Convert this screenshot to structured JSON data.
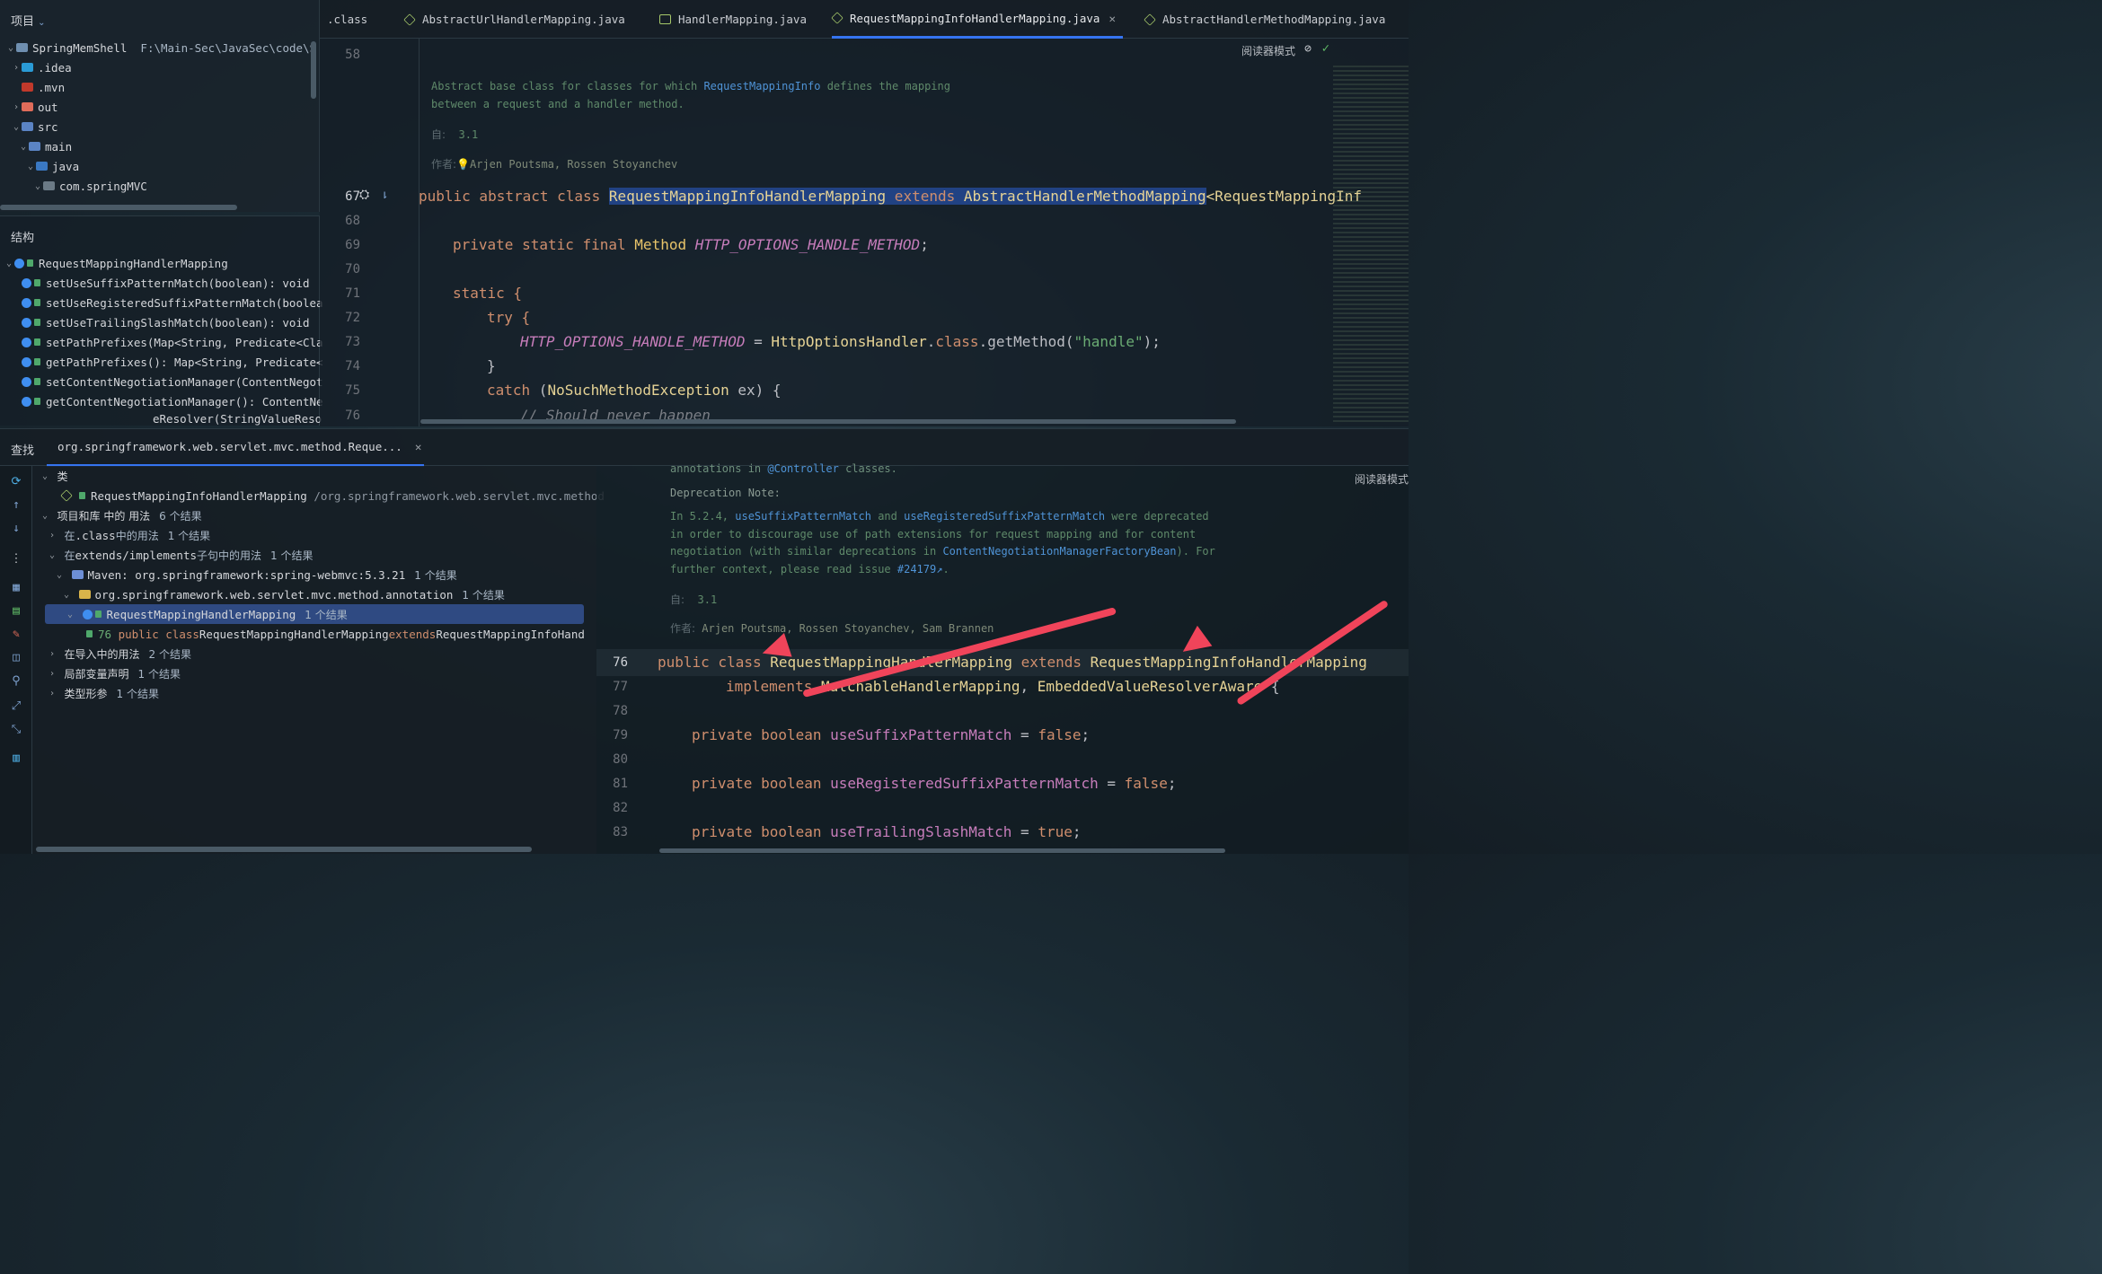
{
  "project_panel": {
    "header": "项目",
    "root_name": "SpringMemShell",
    "root_path": "F:\\Main-Sec\\JavaSec\\code\\S",
    "items": [
      ".idea",
      ".mvn",
      "out",
      "src",
      "main",
      "java",
      "com.springMVC"
    ]
  },
  "structure_panel": {
    "title": "结构",
    "class_name": "RequestMappingHandlerMapping",
    "members": [
      "setUseSuffixPatternMatch(boolean): void",
      "setUseRegisteredSuffixPatternMatch(boolea",
      "setUseTrailingSlashMatch(boolean): void",
      "setPathPrefixes(Map<String, Predicate<Cla",
      "getPathPrefixes(): Map<String, Predicate<",
      "setContentNegotiationManager(ContentNegot",
      "getContentNegotiationManager(): ContentNe",
      "eResolver(StringValueReso"
    ]
  },
  "editor_tabs": [
    {
      "label": ".class"
    },
    {
      "label": "AbstractUrlHandlerMapping.java"
    },
    {
      "label": "HandlerMapping.java"
    },
    {
      "label": "RequestMappingInfoHandlerMapping.java",
      "active": true
    },
    {
      "label": "AbstractHandlerMethodMapping.java"
    }
  ],
  "reader_mode_label": "阅读器模式",
  "editor_top": {
    "line_numbers": [
      "58",
      "67",
      "68",
      "69",
      "70",
      "71",
      "72",
      "73",
      "74",
      "75",
      "76"
    ],
    "doc": {
      "line1_a": "Abstract base class for classes for which ",
      "line1_ref": "RequestMappingInfo",
      "line1_b": " defines the mapping",
      "line2": "between a request and a handler method.",
      "since_label": "自:",
      "since_value": "3.1",
      "author_label": "作者:",
      "authors": "Arjen Poutsma, Rossen Stoyanchev"
    },
    "code": {
      "l67_kw": "public abstract class ",
      "l67_cls": "RequestMappingInfoHandlerMapping",
      "l67_ext": " extends ",
      "l67_parent": "AbstractHandlerMethodMapping",
      "l67_rest": "<RequestMappingInf",
      "l69_kw": "private static final ",
      "l69_type": "Method ",
      "l69_field": "HTTP_OPTIONS_HANDLE_METHOD",
      "l69_end": ";",
      "l71": "static {",
      "l72": "try {",
      "l73_field": "HTTP_OPTIONS_HANDLE_METHOD",
      "l73_eq": " = ",
      "l73_cls": "HttpOptionsHandler",
      "l73_dot": ".",
      "l73_kw": "class",
      "l73_call": ".getMethod(",
      "l73_str": "\"handle\"",
      "l73_end": ");",
      "l74": "}",
      "l75_kw": "catch ",
      "l75_rest1": "(",
      "l75_cls": "NoSuchMethodException",
      "l75_rest2": " ex) {",
      "l76": "// Should never happen"
    }
  },
  "find_panel": {
    "tab_label": "查找",
    "search_tab": "org.springframework.web.servlet.mvc.method.Reque...",
    "rows": {
      "class_group": "类",
      "class_item": "RequestMappingInfoHandlerMapping",
      "class_item_pkg": "/org.springframework.web.servlet.mvc.method",
      "usages_label": "项目和库 中的 用法",
      "usages_count": "6 个结果",
      "dotclass_a": "在 ",
      "dotclass_b": ".class",
      "dotclass_c": " 中的用法",
      "dotclass_count": "1 个结果",
      "ext_a": "在 ",
      "ext_b": "extends/implements",
      "ext_c": " 子句中的用法",
      "ext_count": "1 个结果",
      "maven": "Maven: org.springframework:spring-webmvc:5.3.21",
      "maven_count": "1 个结果",
      "pkg": "org.springframework.web.servlet.mvc.method.annotation",
      "pkg_count": "1 个结果",
      "sel_class": "RequestMappingHandlerMapping",
      "sel_count": "1 个结果",
      "usage_line": "76",
      "usage_kw": "public class ",
      "usage_name": "RequestMappingHandlerMapping",
      "usage_ext": " extends ",
      "usage_parent": "RequestMappingInfoHand",
      "import_label": "在导入中的用法",
      "import_count": "2 个结果",
      "local_label": "局部变量声明",
      "local_count": "1 个结果",
      "type_label": "类型形参",
      "type_count": "1 个结果"
    }
  },
  "editor_bottom": {
    "reader_mode_label": "阅读器模式",
    "line_numbers": [
      "76",
      "77",
      "78",
      "79",
      "80",
      "81",
      "82",
      "83"
    ],
    "doc": {
      "top_a": "annotations in ",
      "top_ref": "@Controller",
      "top_b": " classes.",
      "note_title": "Deprecation Note:",
      "note1_a": "In 5.2.4, ",
      "note1_ref1": "useSuffixPatternMatch",
      "note1_b": " and ",
      "note1_ref2": "useRegisteredSuffixPatternMatch",
      "note1_c": " were deprecated",
      "note2": "in order to discourage use of path extensions for request mapping and for content",
      "note3_a": "negotiation (with similar deprecations in ",
      "note3_ref": "ContentNegotiationManagerFactoryBean",
      "note3_b": "). For",
      "note4_a": "further context, please read issue ",
      "note4_ref": "#24179",
      "note4_b": ".",
      "since_label": "自:",
      "since_value": "3.1",
      "author_label": "作者:",
      "authors": "Arjen Poutsma, Rossen Stoyanchev, Sam Brannen"
    },
    "code": {
      "l76_kw": "public class ",
      "l76_cls": "RequestMappingHandlerMapping",
      "l76_ext": " extends ",
      "l76_parent": "RequestMappingInfoHandlerMapping",
      "l77_kw": "implements ",
      "l77_i1": "MatchableHandlerMapping",
      "l77_sep": ", ",
      "l77_i2": "EmbeddedValueResolverAware",
      "l77_end": " {",
      "l79_kw": "private boolean ",
      "l79_f": "useSuffixPatternMatch",
      "l79_eq": " = ",
      "l79_v": "false",
      "l79_end": ";",
      "l81_kw": "private boolean ",
      "l81_f": "useRegisteredSuffixPatternMatch",
      "l81_eq": " = ",
      "l81_v": "false",
      "l81_end": ";",
      "l83_kw": "private boolean ",
      "l83_f": "useTrailingSlashMatch",
      "l83_eq": " = ",
      "l83_v": "true",
      "l83_end": ";"
    }
  },
  "colors": {
    "keyword": "#cf8e6d",
    "class_name": "#e6d395",
    "field": "#c77dbb",
    "string": "#6aab73",
    "selection": "#214283",
    "annotation_arrow": "#f0445a",
    "tab_underline": "#3574f0"
  },
  "icons": [
    "chevron-down-icon",
    "chevron-right-icon",
    "folder-icon",
    "java-class-icon",
    "interface-icon",
    "close-icon",
    "refresh-icon",
    "arrow-up-icon",
    "arrow-down-icon",
    "more-icon",
    "expand-icon",
    "collapse-icon",
    "reader-mode-icon",
    "check-icon",
    "bulb-icon",
    "lock-icon"
  ]
}
